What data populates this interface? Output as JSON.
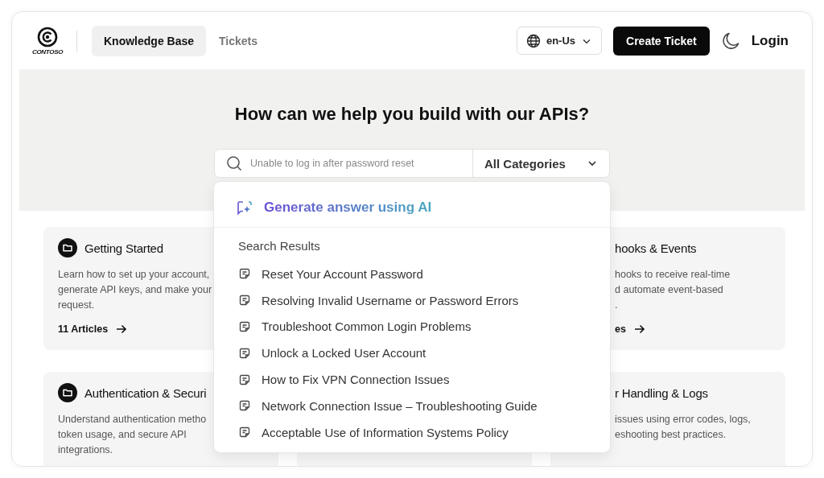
{
  "header": {
    "logo_text": "CONTOSO",
    "tabs": [
      {
        "label": "Knowledge Base",
        "selected": true
      },
      {
        "label": "Tickets",
        "selected": false
      }
    ],
    "language": "en-Us",
    "create_button": "Create Ticket",
    "login": "Login"
  },
  "hero": {
    "title": "How can we help you build with our APIs?",
    "search": {
      "placeholder": "Unable to log in after password reset"
    },
    "category": "All Categories"
  },
  "dropdown": {
    "ai_action": "Generate answer using AI",
    "section_title": "Search Results",
    "results": [
      "Reset Your Account Password",
      "Resolving Invalid Username or Password Errors",
      "Troubleshoot Common Login Problems",
      "Unlock a Locked User Account",
      "How to Fix VPN Connection Issues",
      "Network Connection Issue – Troubleshooting Guide",
      "Acceptable Use of Information Systems Policy"
    ]
  },
  "cards": [
    {
      "title": "Getting Started",
      "lines": [
        "Learn how to set up your account,",
        "generate API keys, and make your",
        "request."
      ],
      "link": "11 Articles"
    },
    {
      "title": "hooks & Events",
      "lines": [
        "hooks to receive real-time",
        "d automate event-based",
        "."
      ],
      "link": "es"
    },
    {
      "title": "Authentication & Securi",
      "lines": [
        "Understand authentication metho",
        "token usage, and secure API",
        "integrations."
      ]
    },
    {
      "title": "r Handling & Logs",
      "lines": [
        "issues using error codes, logs,",
        "eshooting best practices."
      ]
    }
  ]
}
